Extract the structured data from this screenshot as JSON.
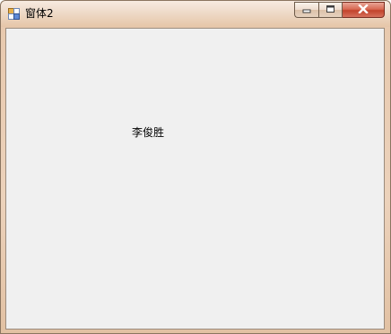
{
  "window": {
    "title": "窗体2",
    "icon": "app-form-icon"
  },
  "caption_buttons": {
    "minimize": "minimize-icon",
    "maximize": "maximize-icon",
    "close": "close-icon"
  },
  "client": {
    "label_text": "李俊胜"
  },
  "colors": {
    "client_background": "#f0f0f0",
    "close_button": "#c2432c",
    "frame": "#e8c9ae"
  }
}
